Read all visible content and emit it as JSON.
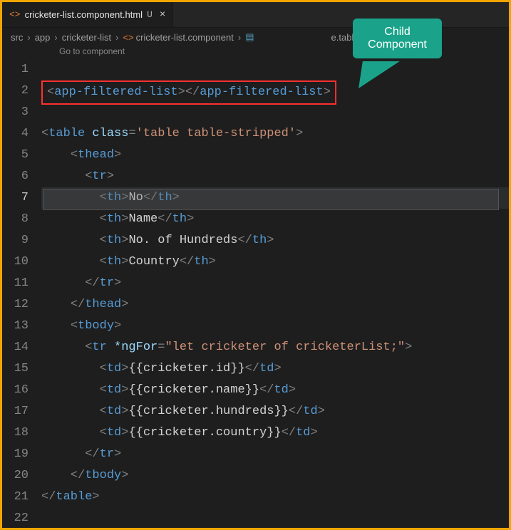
{
  "tab": {
    "filename": "cricketer-list.component.html",
    "dirty": "U"
  },
  "breadcrumb": {
    "items": [
      "src",
      "app",
      "cricketer-list",
      "cricketer-list.component",
      "e.table.tabl"
    ],
    "sep": "›"
  },
  "codelens": "Go to component",
  "callout": {
    "line1": "Child",
    "line2": "Component"
  },
  "lines": [
    "1",
    "2",
    "3",
    "4",
    "5",
    "6",
    "7",
    "8",
    "9",
    "10",
    "11",
    "12",
    "13",
    "14",
    "15",
    "16",
    "17",
    "18",
    "19",
    "20",
    "21",
    "22"
  ],
  "active_line": "7",
  "code": {
    "appfilter": "app-filtered-list",
    "table_open": {
      "tag": "table",
      "class_attr": "class",
      "class_val": "'table table-stripped'"
    },
    "thead": "thead",
    "tr": "tr",
    "th": "th",
    "tbody": "tbody",
    "td": "td",
    "ngfor_attr": "*ngFor",
    "ngfor_val": "\"let cricketer of cricketerList;\"",
    "th_values": {
      "no": "No",
      "name": "Name",
      "hundreds": "No. of Hundreds",
      "country": "Country"
    },
    "td_values": {
      "id": "{{cricketer.id}}",
      "name": "{{cricketer.name}}",
      "hundreds": "{{cricketer.hundreds}}",
      "country": "{{cricketer.country}}"
    }
  }
}
